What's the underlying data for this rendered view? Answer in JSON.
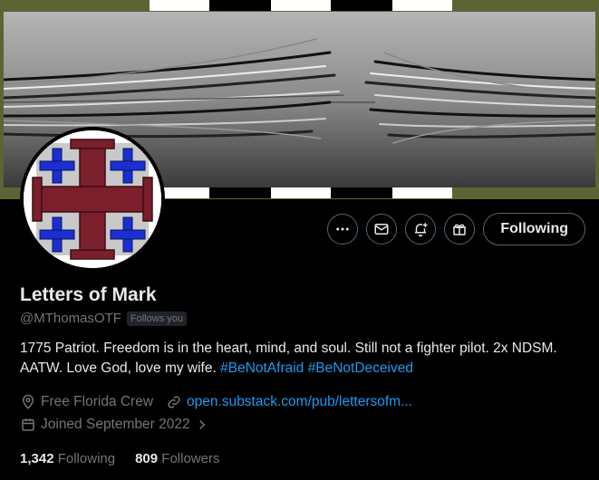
{
  "profile": {
    "display_name": "Letters of Mark",
    "handle": "@MThomasOTF",
    "follows_you": "Follows you",
    "bio_text": "1775 Patriot. Freedom is in the heart, mind, and soul. Still not a fighter pilot. 2x NDSM. AATW. Love God, love my wife.",
    "hashtags": [
      "#BeNotAfraid",
      "#BeNotDeceived"
    ],
    "location": "Free Florida Crew",
    "website": "open.substack.com/pub/lettersofm...",
    "joined": "Joined September 2022"
  },
  "actions": {
    "more_icon": "more-icon",
    "message_icon": "envelope-icon",
    "notify_icon": "bell-plus-icon",
    "subscribe_icon": "gift-icon",
    "follow_label": "Following"
  },
  "stats": {
    "following_count": "1,342",
    "following_label": "Following",
    "followers_count": "809",
    "followers_label": "Followers"
  },
  "colors": {
    "background": "#000000",
    "accent": "#1d9bf0",
    "muted": "#71767b",
    "text": "#e7e9ea",
    "avatar_cross": "#7a1f2b",
    "avatar_small_cross": "#1a2fd0",
    "banner_frame": "#5b6534"
  }
}
